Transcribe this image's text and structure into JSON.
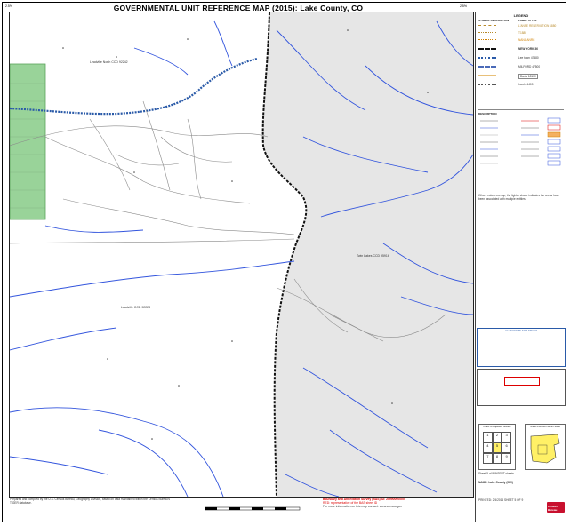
{
  "title": "GOVERNMENTAL UNIT REFERENCE MAP (2015): Lake County, CO",
  "corner_tl": "2.5%",
  "corner_tr": "2.5%",
  "map": {
    "place_labels": [
      {
        "id": "leadville-north",
        "text": "Leadville North CCD 92242"
      },
      {
        "id": "leadville",
        "text": "Leadville CCD 92223"
      },
      {
        "id": "twin-lakes",
        "text": "Twin Lakes CCD 95916"
      }
    ],
    "colors": {
      "water": "#3355dd",
      "roads": "#888888",
      "boundary": "#111111",
      "county_boundary": "#2a5aa8",
      "federal_land": "#7fc07f",
      "shade": "#e6e6e6"
    }
  },
  "legend": {
    "heading": "LEGEND",
    "col_symbol": "SYMBOL DESCRIPTION",
    "col_style": "LABEL STYLE",
    "rows": [
      {
        "desc": "Federal American Indian Reservation",
        "label": "L'ANSE RESERVATION 1880"
      },
      {
        "desc": "Off-Reservation Trust Land",
        "label": "T1880"
      },
      {
        "desc": "Alaska Native Regional Corp.",
        "label": "NANA ANRC"
      },
      {
        "desc": "State/County Limit",
        "label": "NEW YORK 36"
      },
      {
        "desc": "Minor Civil Division",
        "label": "Lee town 47480"
      },
      {
        "desc": "Consolidated City",
        "label": "MILFORD 47500"
      },
      {
        "desc": "Incorporated Place",
        "label": "Davis 18100"
      },
      {
        "desc": "Census Designated Place",
        "label": "Incoln 4400"
      }
    ],
    "notes_heading": "DESCRIPTION",
    "note_text": "Where colors overlap, the lighter shade indicates the areas have been associated with multiple entities.",
    "info_heading": "ALL SHEETS FOR TRACT",
    "index_heading": "Index to Adjacent Sheets",
    "locator_heading": "Sheet Location within State",
    "sheet_grid": [
      "1",
      "2",
      "3",
      "4",
      "5",
      "6",
      "7",
      "8",
      "9"
    ],
    "highlighted_sheet": "5",
    "sheet_text": "Sheet 5 of 9 INSERT sheets",
    "county_name": "NAME: Lake County (089)",
    "logo_text": "Census Bureau",
    "footer_id": "PRINTED: 2/4/2016 SHEET 5 OF 9"
  },
  "footer": {
    "left_text": "Prepared and compiled by the U.S. Census Bureau, Geography Division, based on data maintained within the Census Bureau's TIGER database.",
    "red_line1": "Boundary and Annexation Survey (BAS) ID: 20990000000",
    "red_line2": "RED: representative of the BAS sheet ID",
    "mid_text": "For more information on this map contact: www.census.gov"
  }
}
